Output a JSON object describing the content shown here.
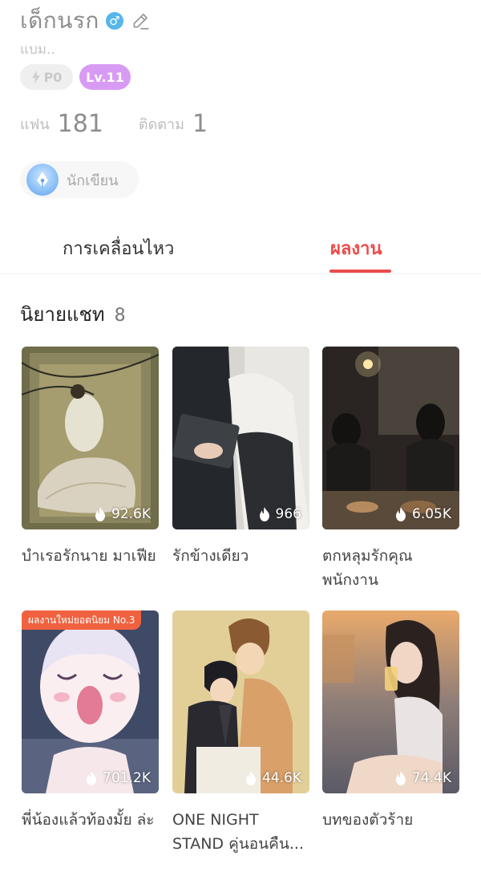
{
  "profile": {
    "name": "เด็กนรก",
    "gender_icon": "male-icon",
    "bio": "แบม..",
    "points_badge": "P0",
    "level_badge": "Lv.11",
    "fans_label": "แฟน",
    "fans_count": "181",
    "following_label": "ติดตาม",
    "following_count": "1",
    "role_label": "นักเขียน"
  },
  "tabs": [
    {
      "label": "การเคลื่อนไหว",
      "active": false
    },
    {
      "label": "ผลงาน",
      "active": true
    }
  ],
  "section": {
    "title": "นิยายแชท",
    "count": "8"
  },
  "works": [
    {
      "title": "บำเรอรักนาย มาเฟีย",
      "views": "92.6K",
      "tag": ""
    },
    {
      "title": "รักข้างเดียว",
      "views": "966",
      "tag": ""
    },
    {
      "title": "ตกหลุมรักคุณ พนักงาน",
      "views": "6.05K",
      "tag": ""
    },
    {
      "title": "พี่น้องแล้วท้องมั้ย ล่ะ",
      "views": "701.2K",
      "tag": "ผลงานใหม่ยอดนิยม No.3"
    },
    {
      "title": "ONE NIGHT STAND คู่นอนคืน...",
      "views": "44.6K",
      "tag": ""
    },
    {
      "title": "บทของตัวร้าย",
      "views": "74.4K",
      "tag": ""
    }
  ],
  "colors": {
    "accent": "#ec4b4b",
    "level_badge": "#d89bf4",
    "tag_bg": "#f0623f"
  }
}
